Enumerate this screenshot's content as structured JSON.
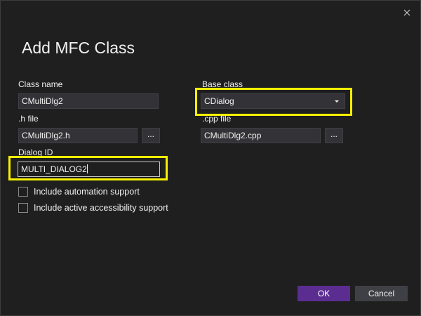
{
  "dialog": {
    "title": "Add MFC Class",
    "close_icon": "close-icon"
  },
  "form": {
    "class_name_label": "Class name",
    "class_name_value": "CMultiDlg2",
    "base_class_label": "Base class",
    "base_class_value": "CDialog",
    "h_file_label": ".h file",
    "h_file_value": "CMultiDlg2.h",
    "cpp_file_label": ".cpp file",
    "cpp_file_value": "CMultiDlg2.cpp",
    "dialog_id_label": "Dialog ID",
    "dialog_id_value": "MULTI_DIALOG2",
    "browse_label": "..."
  },
  "options": [
    {
      "label": "Include automation support",
      "checked": false
    },
    {
      "label": "Include active accessibility support",
      "checked": false
    }
  ],
  "buttons": {
    "ok_label": "OK",
    "cancel_label": "Cancel"
  },
  "colors": {
    "background": "#1f1f1f",
    "accent": "#5c2d91",
    "highlight": "#f6f000"
  }
}
